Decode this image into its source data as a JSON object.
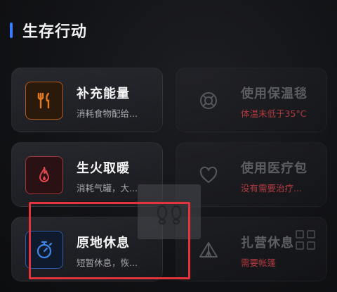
{
  "section": {
    "title": "生存行动"
  },
  "actions": [
    {
      "title": "补充能量",
      "subtitle": "消耗食物配给...",
      "icon": "fork-knife-icon",
      "enabled": true,
      "subtitle_color": "#a7a9ae"
    },
    {
      "title": "使用保温毯",
      "subtitle": "体温未低于35°C",
      "icon": "lifebuoy-icon",
      "enabled": false,
      "subtitle_color": "#b23a3f"
    },
    {
      "title": "生火取暖",
      "subtitle": "消耗气罐，大...",
      "icon": "flame-icon",
      "enabled": true,
      "subtitle_color": "#a7a9ae"
    },
    {
      "title": "使用医疗包",
      "subtitle": "没有需要治疗...",
      "icon": "heart-icon",
      "enabled": false,
      "subtitle_color": "#b23a3f"
    },
    {
      "title": "原地休息",
      "subtitle": "短暂休息，恢...",
      "icon": "stopwatch-icon",
      "enabled": true,
      "subtitle_color": "#a7a9ae"
    },
    {
      "title": "扎营休息",
      "subtitle": "需要帐篷",
      "icon": "tent-icon",
      "enabled": false,
      "subtitle_color": "#b23a3f"
    }
  ],
  "colors": {
    "accent": "#3a7bff",
    "highlight": "#e3343c",
    "energy": "#e07a26",
    "fire": "#e0474f",
    "rest": "#3f86e8",
    "warning": "#b23a3f"
  }
}
